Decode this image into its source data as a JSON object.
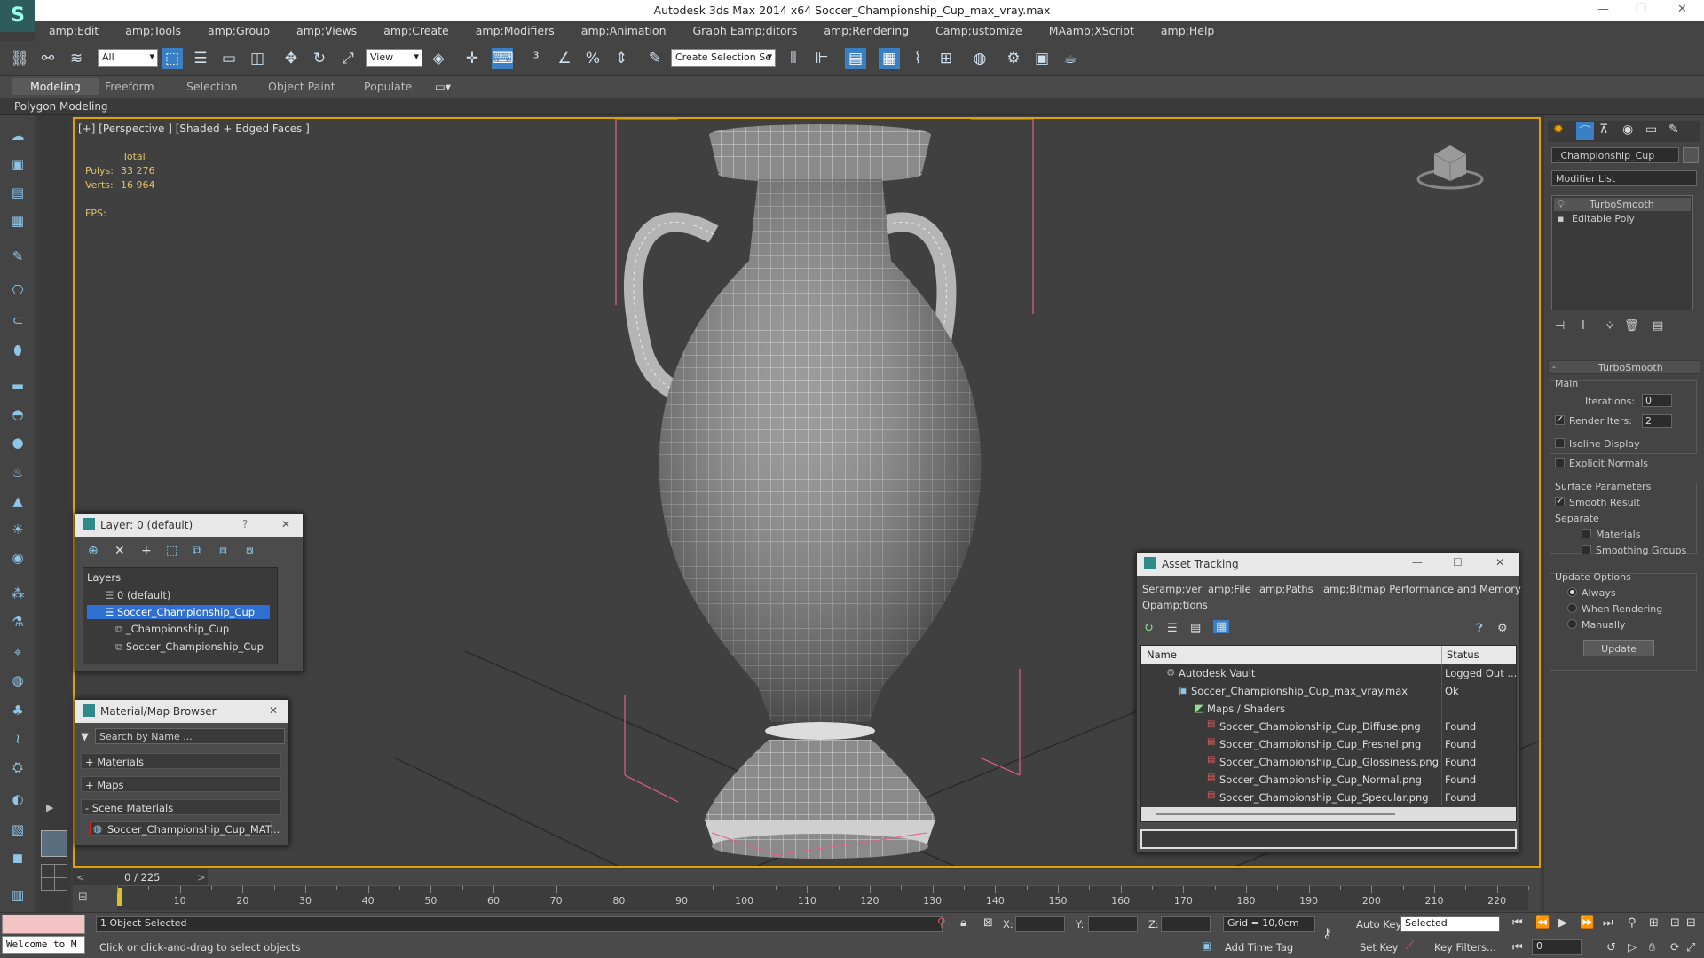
{
  "app": {
    "title": "Autodesk 3ds Max  2014 x64     Soccer_Championship_Cup_max_vray.max"
  },
  "menu": [
    "amp;Edit",
    "amp;Tools",
    "amp;Group",
    "amp;Views",
    "amp;Create",
    "amp;Modifiers",
    "amp;Animation",
    "Graph Eamp;ditors",
    "amp;Rendering",
    "Camp;ustomize",
    "MAamp;XScript",
    "amp;Help"
  ],
  "toolbar": {
    "filter": "All",
    "refcoord": "View",
    "selection_set": "Create Selection Se"
  },
  "ribbon": {
    "tabs": [
      "Modeling",
      "Freeform",
      "Selection",
      "Object Paint",
      "Populate"
    ],
    "sub": "Polygon Modeling"
  },
  "viewport": {
    "label": "[+] [Perspective ] [Shaded + Edged Faces ]",
    "total": "Total",
    "polys_label": "Polys:",
    "polys_value": "33 276",
    "verts_label": "Verts:",
    "verts_value": "16 964",
    "fps": "FPS:"
  },
  "command_panel": {
    "object_name": "_Championship_Cup",
    "modifier_list": "Modifier List",
    "stack": [
      "TurboSmooth",
      "Editable Poly"
    ],
    "rollout_title": "TurboSmooth",
    "main_label": "Main",
    "iterations_label": "Iterations:",
    "iterations_value": "0",
    "render_iters_label": "Render Iters:",
    "render_iters_value": "2",
    "render_iters_checked": true,
    "isoline": "Isoline Display",
    "explicit_normals": "Explicit Normals",
    "surface_params": "Surface Parameters",
    "smooth_result": "Smooth Result",
    "separate": "Separate",
    "materials": "Materials",
    "smoothing_groups": "Smoothing Groups",
    "update_options": "Update Options",
    "always": "Always",
    "when_rendering": "When Rendering",
    "manually": "Manually",
    "update_button": "Update"
  },
  "layer_dialog": {
    "title": "Layer: 0 (default)",
    "help": "?",
    "header": "Layers",
    "items": [
      "0 (default)",
      "Soccer_Championship_Cup",
      "_Championship_Cup",
      "Soccer_Championship_Cup"
    ]
  },
  "material_browser": {
    "title": "Material/Map Browser",
    "search_placeholder": "Search by Name ...",
    "groups": [
      "+ Materials",
      "+ Maps",
      "- Scene Materials"
    ],
    "scene_material": "Soccer_Championship_Cup_MAT..."
  },
  "asset_tracking": {
    "title": "Asset Tracking",
    "menu": [
      "Seramp;ver",
      "amp;File",
      "amp;Paths",
      "amp;Bitmap Performance and Memory"
    ],
    "menu2": "Opamp;tions",
    "col_name": "Name",
    "col_status": "Status",
    "rows": [
      {
        "name": "Autodesk Vault",
        "status": "Logged Out ..."
      },
      {
        "name": "Soccer_Championship_Cup_max_vray.max",
        "status": "Ok"
      },
      {
        "name": "Maps / Shaders",
        "status": ""
      },
      {
        "name": "Soccer_Championship_Cup_Diffuse.png",
        "status": "Found"
      },
      {
        "name": "Soccer_Championship_Cup_Fresnel.png",
        "status": "Found"
      },
      {
        "name": "Soccer_Championship_Cup_Glossiness.png",
        "status": "Found"
      },
      {
        "name": "Soccer_Championship_Cup_Normal.png",
        "status": "Found"
      },
      {
        "name": "Soccer_Championship_Cup_Specular.png",
        "status": "Found"
      }
    ]
  },
  "timeline": {
    "frame": "0 / 225",
    "ticks": [
      "0",
      "10",
      "20",
      "30",
      "40",
      "50",
      "60",
      "70",
      "80",
      "90",
      "100",
      "110",
      "120",
      "130",
      "140",
      "150",
      "160",
      "170",
      "180",
      "190",
      "200",
      "210",
      "220"
    ]
  },
  "status": {
    "welcome": "Welcome to M",
    "selected": "1 Object Selected",
    "prompt": "Click or click-and-drag to select objects",
    "x_label": "X:",
    "y_label": "Y:",
    "z_label": "Z:",
    "grid": "Grid = 10,0cm",
    "add_time_tag": "Add Time Tag",
    "auto_key": "Auto Key",
    "set_key": "Set Key",
    "selected_dd": "Selected",
    "key_filters": "Key Filters...",
    "frame_value": "0"
  },
  "colors": {
    "accent": "#3a7fc4",
    "viewport_border": "#e0a200",
    "layer_selected": "#2f6fd1"
  }
}
